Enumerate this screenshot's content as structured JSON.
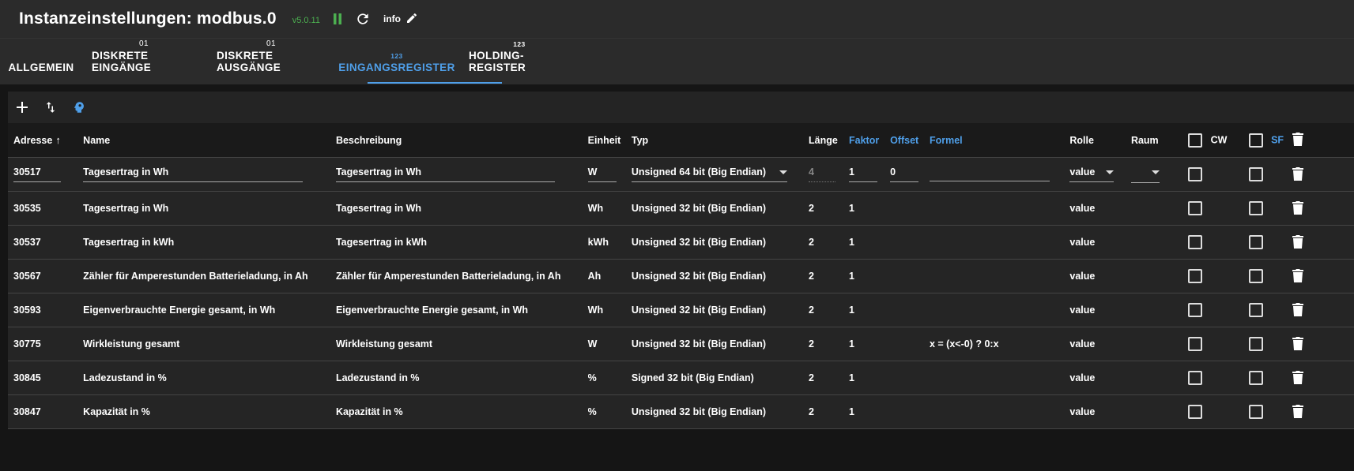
{
  "header": {
    "title": "Instanzeinstellungen: modbus.0",
    "version": "v5.0.11",
    "info_label": "info"
  },
  "tabs": [
    {
      "label": "ALLGEMEIN",
      "badge": ""
    },
    {
      "label": "DISKRETE EINGÄNGE",
      "badge": "01"
    },
    {
      "label": "DISKRETE AUSGÄNGE",
      "badge": "01"
    },
    {
      "label": "EINGANGSREGISTER",
      "badge": "123"
    },
    {
      "label": "HOLDING-REGISTER",
      "badge": "123"
    }
  ],
  "active_tab": "EINGANGSREGISTER",
  "toolbar": {
    "icons": [
      "add-icon",
      "import-export-icon",
      "head-icon"
    ]
  },
  "table": {
    "columns": {
      "adresse": "Adresse",
      "name": "Name",
      "beschreibung": "Beschreibung",
      "einheit": "Einheit",
      "typ": "Typ",
      "laenge": "Länge",
      "faktor": "Faktor",
      "offset": "Offset",
      "formel": "Formel",
      "rolle": "Rolle",
      "raum": "Raum",
      "cw": "CW",
      "sf": "SF"
    },
    "rows": [
      {
        "adresse": "30517",
        "name": "Tagesertrag in Wh",
        "beschreibung": "Tagesertrag in Wh",
        "einheit": "W",
        "typ": "Unsigned 64 bit (Big Endian)",
        "laenge": "4",
        "faktor": "1",
        "offset": "0",
        "formel": "",
        "rolle": "value",
        "raum": ""
      },
      {
        "adresse": "30535",
        "name": "Tagesertrag in Wh",
        "beschreibung": "Tagesertrag in Wh",
        "einheit": "Wh",
        "typ": "Unsigned 32 bit (Big Endian)",
        "laenge": "2",
        "faktor": "1",
        "offset": "",
        "formel": "",
        "rolle": "value",
        "raum": ""
      },
      {
        "adresse": "30537",
        "name": "Tagesertrag in kWh",
        "beschreibung": "Tagesertrag in kWh",
        "einheit": "kWh",
        "typ": "Unsigned 32 bit (Big Endian)",
        "laenge": "2",
        "faktor": "1",
        "offset": "",
        "formel": "",
        "rolle": "value",
        "raum": ""
      },
      {
        "adresse": "30567",
        "name": "Zähler für Amperestunden Batterieladung, in Ah",
        "beschreibung": "Zähler für Amperestunden Batterieladung, in Ah",
        "einheit": "Ah",
        "typ": "Unsigned 32 bit (Big Endian)",
        "laenge": "2",
        "faktor": "1",
        "offset": "",
        "formel": "",
        "rolle": "value",
        "raum": ""
      },
      {
        "adresse": "30593",
        "name": "Eigenverbrauchte Energie gesamt, in Wh",
        "beschreibung": "Eigenverbrauchte Energie gesamt, in Wh",
        "einheit": "Wh",
        "typ": "Unsigned 32 bit (Big Endian)",
        "laenge": "2",
        "faktor": "1",
        "offset": "",
        "formel": "",
        "rolle": "value",
        "raum": ""
      },
      {
        "adresse": "30775",
        "name": "Wirkleistung gesamt",
        "beschreibung": "Wirkleistung gesamt",
        "einheit": "W",
        "typ": "Unsigned 32 bit (Big Endian)",
        "laenge": "2",
        "faktor": "1",
        "offset": "",
        "formel": "x = (x<-0) ? 0:x",
        "rolle": "value",
        "raum": ""
      },
      {
        "adresse": "30845",
        "name": "Ladezustand in %",
        "beschreibung": "Ladezustand in %",
        "einheit": "%",
        "typ": "Signed 32 bit (Big Endian)",
        "laenge": "2",
        "faktor": "1",
        "offset": "",
        "formel": "",
        "rolle": "value",
        "raum": ""
      },
      {
        "adresse": "30847",
        "name": "Kapazität in %",
        "beschreibung": "Kapazität in %",
        "einheit": "%",
        "typ": "Unsigned 32 bit (Big Endian)",
        "laenge": "2",
        "faktor": "1",
        "offset": "",
        "formel": "",
        "rolle": "value",
        "raum": ""
      }
    ]
  },
  "colors": {
    "accent": "#4f9fe9",
    "version_green": "#4caf50",
    "pause_green": "#4caf50",
    "toolbar_head_icon": "#4f9fe9"
  }
}
